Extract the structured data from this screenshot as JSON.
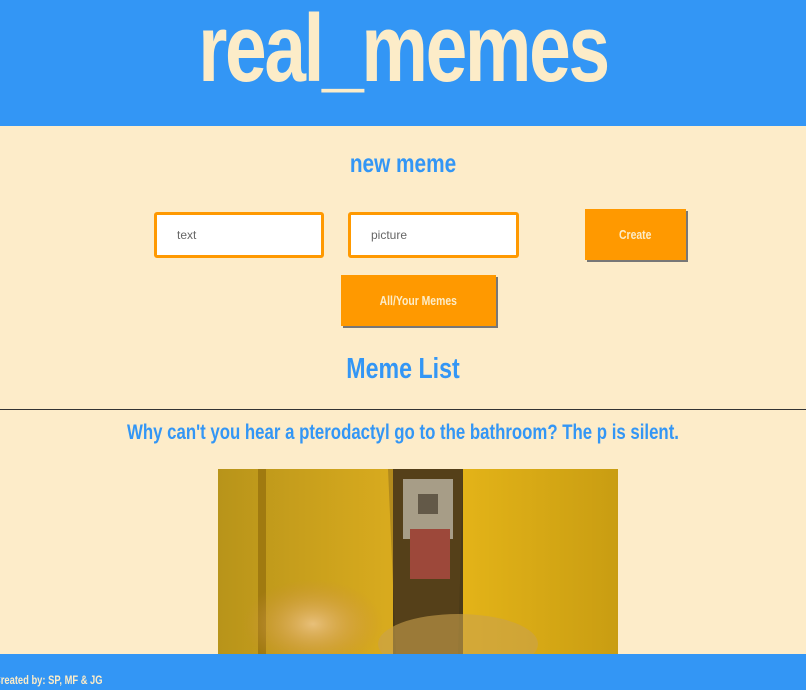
{
  "header": {
    "title": "real_memes"
  },
  "new_meme": {
    "heading": "new meme",
    "text_field": {
      "placeholder": "text",
      "value": ""
    },
    "picture_field": {
      "placeholder": "picture",
      "value": ""
    },
    "create_label": "Create",
    "toggle_label": "All/Your Memes"
  },
  "meme_list": {
    "heading": "Meme List",
    "items": [
      {
        "text": "Why can't you hear a pterodactyl go to the bathroom? The p is silent.",
        "image": "meme-photo"
      }
    ]
  },
  "footer": {
    "credit": "Created by: SP, MF & JG"
  },
  "colors": {
    "brand_blue": "#3396f5",
    "background": "#fdecc9",
    "accent_orange": "#ff9900",
    "cream_text": "#fcecc8"
  }
}
